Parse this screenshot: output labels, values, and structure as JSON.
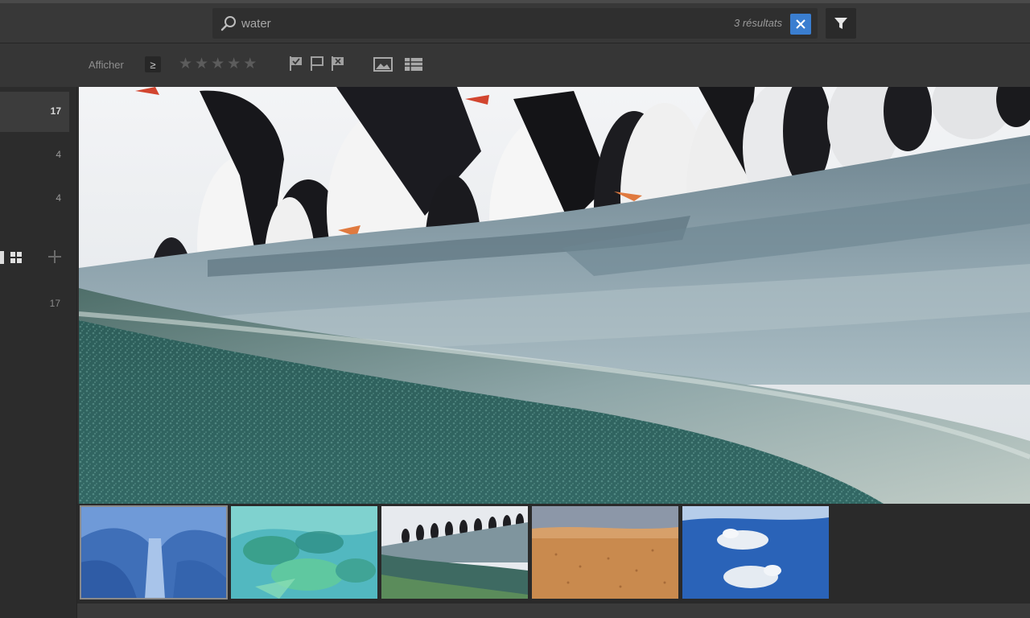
{
  "search": {
    "value": "water",
    "results_text": "3 résultats",
    "clear_icon": "close-icon",
    "search_icon": "search-icon",
    "filter_icon": "funnel-icon"
  },
  "toolbar": {
    "show_label": "Afficher",
    "comparison_symbol": "≥",
    "stars": [
      "★",
      "★",
      "★",
      "★",
      "★"
    ],
    "flags": [
      "flag-picked-icon",
      "flag-unflagged-icon",
      "flag-rejected-icon"
    ],
    "views": [
      "loupe-view-icon",
      "grid-view-icon"
    ]
  },
  "sidebar": {
    "items": [
      {
        "count": "17",
        "active": true
      },
      {
        "count": "4",
        "active": false
      },
      {
        "count": "4",
        "active": false
      }
    ],
    "grid_icon": "grid-icon",
    "add_icon": "plus-icon",
    "total_count": "17"
  },
  "filmstrip": {
    "thumbnails": [
      {
        "name": "ice-cave",
        "selected": true
      },
      {
        "name": "fish-underwater",
        "selected": false
      },
      {
        "name": "penguins-waterline",
        "selected": false
      },
      {
        "name": "sand-desert",
        "selected": false
      },
      {
        "name": "polar-bears-swimming",
        "selected": false
      }
    ]
  },
  "colors": {
    "accent": "#3a7ed0",
    "panel": "#363636",
    "background": "#2c2c2c"
  }
}
